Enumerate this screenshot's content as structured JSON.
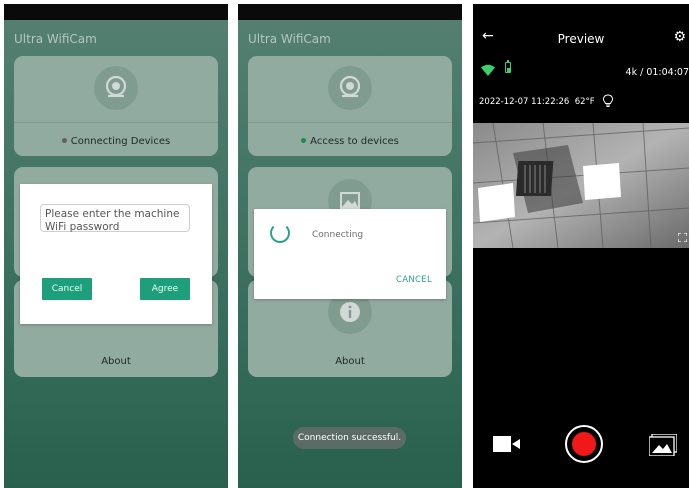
{
  "screen1": {
    "app_title": "Ultra WifiCam",
    "card_connect": {
      "label": "Connecting Devices",
      "dot_color": "#6b6b6b"
    },
    "card_about": {
      "label": "About"
    },
    "dialog": {
      "placeholder": "Please enter the machine WiFi password",
      "cancel_label": "Cancel",
      "agree_label": "Agree"
    }
  },
  "screen2": {
    "app_title": "Ultra WifiCam",
    "card_access": {
      "label": "Access to devices",
      "dot_color": "#1f9a57"
    },
    "card_about": {
      "label": "About"
    },
    "dialog": {
      "message": "Connecting",
      "cancel_label": "CANCEL"
    },
    "toast": "Connection successful."
  },
  "screen3": {
    "title": "Preview",
    "resolution_time": "4k / 01:04:07",
    "timestamp": "2022-12-07 11:22:26",
    "temperature": "62°F"
  },
  "colors": {
    "accent": "#1e9f7c",
    "cancel_text": "#2aa58c",
    "record": "#f01818"
  },
  "icons": [
    "camera-icon",
    "image-icon",
    "info-icon",
    "back-arrow-icon",
    "gear-icon",
    "wifi-icon",
    "battery-icon",
    "bulb-icon",
    "fullscreen-icon",
    "video-camera-icon",
    "record-icon",
    "gallery-icon"
  ]
}
